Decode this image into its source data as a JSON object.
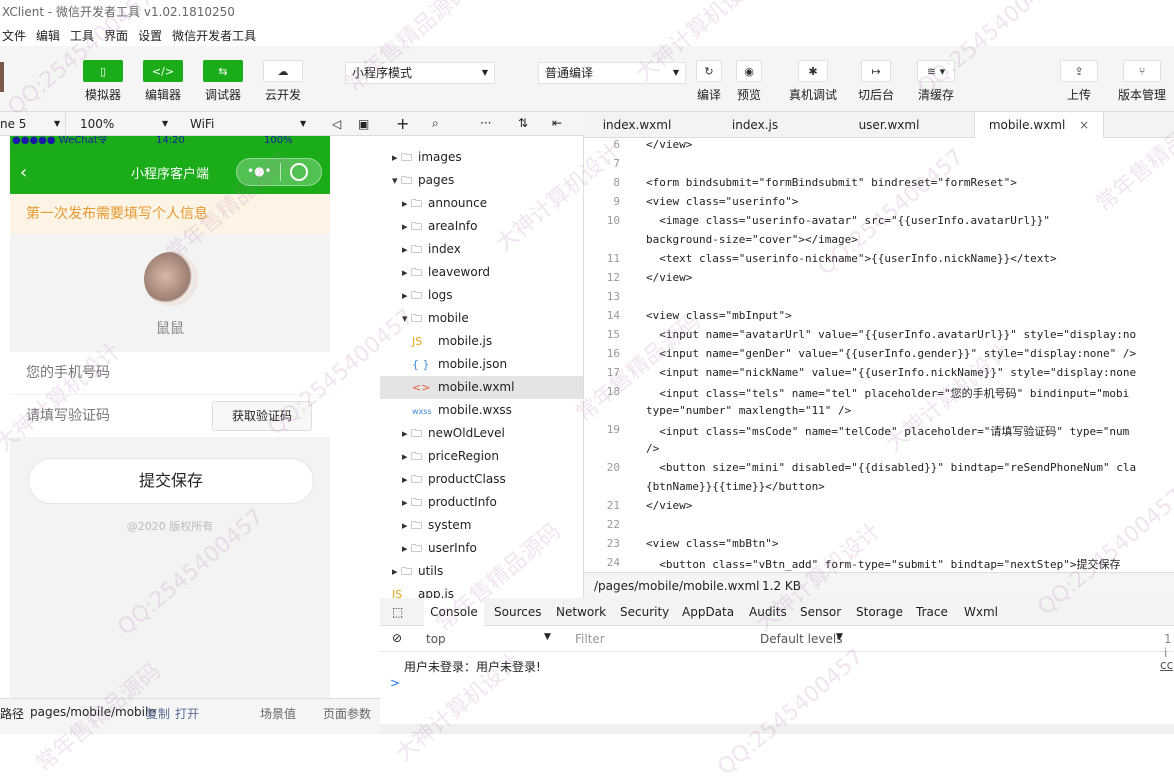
{
  "window": {
    "title": "XClient - 微信开发者工具 v1.02.1810250"
  },
  "menu": [
    "文件",
    "编辑",
    "工具",
    "界面",
    "设置",
    "微信开发者工具"
  ],
  "toolbar": {
    "simulator": "模拟器",
    "editor": "编辑器",
    "debugger": "调试器",
    "cloud": "云开发",
    "mode": "小程序模式",
    "compile_mode": "普通编译",
    "compile": "编译",
    "preview": "预览",
    "remote_debug": "真机调试",
    "background": "切后台",
    "clear_cache": "清缓存",
    "upload": "上传",
    "version": "版本管理"
  },
  "simulator": {
    "device": "ne 5",
    "zoom": "100%",
    "network": "WiFi",
    "status_carrier": "●●●●● WeChat令",
    "status_time": "14:20",
    "status_battery": "100%",
    "nav_title": "小程序客户端",
    "notice": "第一次发布需要填写个人信息",
    "nickname": "鼠鼠",
    "phone_placeholder": "您的手机号码",
    "code_placeholder": "请填写验证码",
    "get_code": "获取验证码",
    "save": "提交保存",
    "copyright": "@2020 版权所有"
  },
  "simfooter": {
    "label": "路径",
    "path": "pages/mobile/mobile",
    "copy": "复制",
    "open": "打开",
    "scene": "场景值",
    "params": "页面参数"
  },
  "tree": [
    {
      "label": "images",
      "type": "folder",
      "depth": 0,
      "open": false
    },
    {
      "label": "pages",
      "type": "folder",
      "depth": 0,
      "open": true
    },
    {
      "label": "announce",
      "type": "folder",
      "depth": 1,
      "open": false
    },
    {
      "label": "areaInfo",
      "type": "folder",
      "depth": 1,
      "open": false
    },
    {
      "label": "index",
      "type": "folder",
      "depth": 1,
      "open": false
    },
    {
      "label": "leaveword",
      "type": "folder",
      "depth": 1,
      "open": false
    },
    {
      "label": "logs",
      "type": "folder",
      "depth": 1,
      "open": false
    },
    {
      "label": "mobile",
      "type": "folder",
      "depth": 1,
      "open": true
    },
    {
      "label": "mobile.js",
      "type": "js",
      "depth": 2
    },
    {
      "label": "mobile.json",
      "type": "json",
      "depth": 2
    },
    {
      "label": "mobile.wxml",
      "type": "wxml",
      "depth": 2,
      "selected": true
    },
    {
      "label": "mobile.wxss",
      "type": "wxss",
      "depth": 2
    },
    {
      "label": "newOldLevel",
      "type": "folder",
      "depth": 1,
      "open": false
    },
    {
      "label": "priceRegion",
      "type": "folder",
      "depth": 1,
      "open": false
    },
    {
      "label": "productClass",
      "type": "folder",
      "depth": 1,
      "open": false
    },
    {
      "label": "productInfo",
      "type": "folder",
      "depth": 1,
      "open": false
    },
    {
      "label": "system",
      "type": "folder",
      "depth": 1,
      "open": false
    },
    {
      "label": "userInfo",
      "type": "folder",
      "depth": 1,
      "open": false
    },
    {
      "label": "utils",
      "type": "folder",
      "depth": 0,
      "open": false
    },
    {
      "label": "app.js",
      "type": "js",
      "depth": 0
    }
  ],
  "tabs": [
    "index.wxml",
    "index.js",
    "user.wxml",
    "mobile.wxml"
  ],
  "code": [
    {
      "n": "6",
      "t": "</view>"
    },
    {
      "n": "7",
      "t": ""
    },
    {
      "n": "8",
      "t": "<form bindsubmit=\"formBindsubmit\" bindreset=\"formReset\">"
    },
    {
      "n": "9",
      "t": "<view class=\"userinfo\">"
    },
    {
      "n": "10",
      "t": "  <image class=\"userinfo-avatar\" src=\"{{userInfo.avatarUrl}}\""
    },
    {
      "n": "",
      "t": "background-size=\"cover\"></image>"
    },
    {
      "n": "11",
      "t": "  <text class=\"userinfo-nickname\">{{userInfo.nickName}}</text>"
    },
    {
      "n": "12",
      "t": "</view>"
    },
    {
      "n": "13",
      "t": ""
    },
    {
      "n": "14",
      "t": "<view class=\"mbInput\">"
    },
    {
      "n": "15",
      "t": "  <input name=\"avatarUrl\" value=\"{{userInfo.avatarUrl}}\" style=\"display:no"
    },
    {
      "n": "16",
      "t": "  <input name=\"genDer\" value=\"{{userInfo.gender}}\" style=\"display:none\" />"
    },
    {
      "n": "17",
      "t": "  <input name=\"nickName\" value=\"{{userInfo.nickName}}\" style=\"display:none"
    },
    {
      "n": "18",
      "t": "  <input class=\"tels\" name=\"tel\" placeholder=\"您的手机号码\" bindinput=\"mobi"
    },
    {
      "n": "",
      "t": "type=\"number\" maxlength=\"11\" />"
    },
    {
      "n": "19",
      "t": "  <input class=\"msCode\" name=\"telCode\" placeholder=\"请填写验证码\" type=\"num"
    },
    {
      "n": "",
      "t": "/>"
    },
    {
      "n": "20",
      "t": "  <button size=\"mini\" disabled=\"{{disabled}}\" bindtap=\"reSendPhoneNum\" cla"
    },
    {
      "n": "",
      "t": "{btnName}}{{time}}</button>"
    },
    {
      "n": "21",
      "t": "</view>"
    },
    {
      "n": "22",
      "t": ""
    },
    {
      "n": "23",
      "t": "<view class=\"mbBtn\">"
    },
    {
      "n": "24",
      "t": "  <button class=\"vBtn_add\" form-type=\"submit\" bindtap=\"nextStep\">提交保存"
    }
  ],
  "filestat": {
    "path": "/pages/mobile/mobile.wxml",
    "size": "1.2 KB"
  },
  "devtools": {
    "tabs": [
      "Console",
      "Sources",
      "Network",
      "Security",
      "AppData",
      "Audits",
      "Sensor",
      "Storage",
      "Trace",
      "Wxml"
    ],
    "context": "top",
    "filter_placeholder": "Filter",
    "levels": "Default levels",
    "count": "1 i",
    "log": "用户未登录：用户未登录!",
    "link": "cc",
    "prompt": ">"
  },
  "watermarks": [
    "QQ:2545400457",
    "常年售精品源码",
    "大神计算机设计"
  ]
}
